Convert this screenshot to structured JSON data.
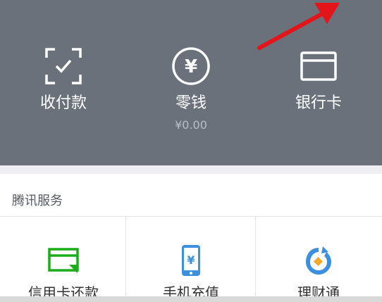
{
  "top": {
    "items": [
      {
        "label": "收付款",
        "icon": "scan-checkmark-icon"
      },
      {
        "label": "零钱",
        "icon": "yuan-circle-icon",
        "sub": "¥0.00"
      },
      {
        "label": "银行卡",
        "icon": "bank-card-icon"
      }
    ]
  },
  "section": {
    "title": "腾讯服务",
    "items": [
      {
        "label": "信用卡还款",
        "icon": "credit-card-repay-icon"
      },
      {
        "label": "手机充值",
        "icon": "phone-recharge-icon"
      },
      {
        "label": "理财通",
        "icon": "wealth-management-icon"
      }
    ]
  },
  "colors": {
    "panel": "#6b717b",
    "accent_green": "#1aad19",
    "accent_blue": "#3d8fe0",
    "annotation_red": "#e3141a"
  }
}
